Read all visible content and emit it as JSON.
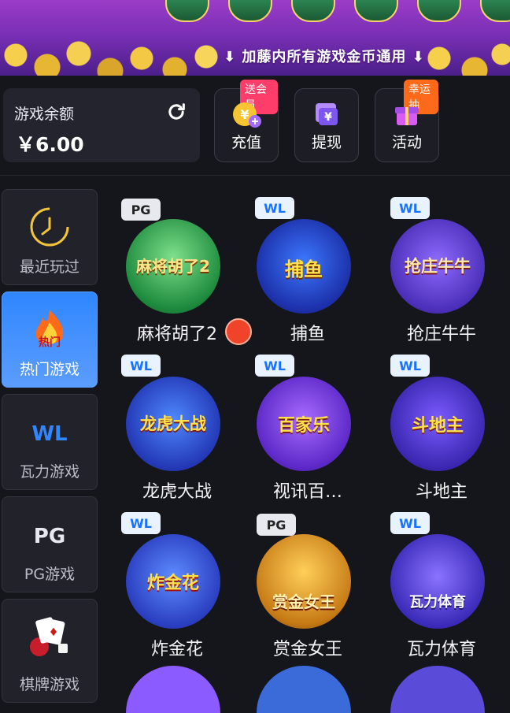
{
  "banner": {
    "tagline": "加藤内所有游戏金币通用",
    "arrow_left": "⬇",
    "arrow_right": "⬇"
  },
  "wallet": {
    "label": "游戏余额",
    "amount": "￥6.00"
  },
  "actions": [
    {
      "label": "充值",
      "badge": "送会员",
      "icon": "coin-plus-icon"
    },
    {
      "label": "提现",
      "badge": "",
      "icon": "withdraw-icon"
    },
    {
      "label": "活动",
      "badge": "幸运抽",
      "icon": "gift-icon"
    }
  ],
  "sidebar": {
    "items": [
      {
        "label": "最近玩过",
        "icon": "clock-icon"
      },
      {
        "label": "热门游戏",
        "icon": "hot-flame-icon",
        "icon_text": "热门"
      },
      {
        "label": "瓦力游戏",
        "icon": "wl-logo-icon",
        "icon_text": "WL"
      },
      {
        "label": "PG游戏",
        "icon": "pg-logo-icon",
        "icon_text": "PG"
      },
      {
        "label": "棋牌游戏",
        "icon": "cards-icon"
      }
    ]
  },
  "games": [
    {
      "name": "麻将胡了2",
      "provider": "PG",
      "art": "麻将胡了2"
    },
    {
      "name": "捕鱼",
      "provider": "WL",
      "art": "捕鱼"
    },
    {
      "name": "抢庄牛牛",
      "provider": "WL",
      "art": "抢庄牛牛"
    },
    {
      "name": "龙虎大战",
      "provider": "WL",
      "art": "龙虎大战"
    },
    {
      "name": "视讯百…",
      "provider": "WL",
      "art": "百家乐"
    },
    {
      "name": "斗地主",
      "provider": "WL",
      "art": "斗地主"
    },
    {
      "name": "炸金花",
      "provider": "WL",
      "art": "炸金花"
    },
    {
      "name": "赏金女王",
      "provider": "PG",
      "art": "赏金女王"
    },
    {
      "name": "瓦力体育",
      "provider": "WL",
      "art": "瓦力体育"
    }
  ],
  "colors": {
    "background": "#15151c",
    "active_tab": "#2f86ff",
    "badge_pink": "#ff3d6b",
    "badge_orange": "#ff6a1a"
  }
}
